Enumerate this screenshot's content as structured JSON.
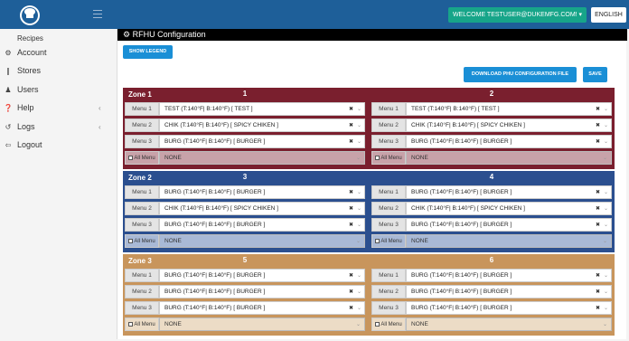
{
  "header": {
    "welcome": "WELCOME TESTUSER@DUKEMFG.COM! ▾",
    "language": "ENGLISH"
  },
  "sidebar": {
    "items": [
      {
        "label": "Recipes",
        "icon": "",
        "caret": ""
      },
      {
        "label": "Account",
        "icon": "⚙",
        "caret": ""
      },
      {
        "label": "Stores",
        "icon": "❙",
        "caret": ""
      },
      {
        "label": "Users",
        "icon": "♟",
        "caret": ""
      },
      {
        "label": "Help",
        "icon": "❓",
        "caret": "‹"
      },
      {
        "label": "Logs",
        "icon": "↺",
        "caret": "‹"
      },
      {
        "label": "Logout",
        "icon": "⇦",
        "caret": ""
      }
    ]
  },
  "page": {
    "title": "RFHU Configuration",
    "title_icon": "⚙",
    "show_legend": "SHOW LEGEND",
    "download": "DOWNLOAD PHU CONFIGURATION FILE",
    "save": "SAVE"
  },
  "zones": [
    {
      "name": "Zone 1",
      "color": "#7a1f2e",
      "tint": "#c8a2a9",
      "cols": [
        {
          "number": "1",
          "menus": [
            {
              "label": "Menu 1",
              "value": "TEST (T:140°F| B:140°F) [ TEST ]"
            },
            {
              "label": "Menu 2",
              "value": "CHIK (T:140°F| B:140°F) [ SPICY CHIKEN ]"
            },
            {
              "label": "Menu 3",
              "value": "BURG (T:140°F| B:140°F) [ BURGER ]"
            }
          ],
          "all_label": "All Menu",
          "all_value": "NONE"
        },
        {
          "number": "2",
          "menus": [
            {
              "label": "Menu 1",
              "value": "TEST (T:140°F| B:140°F) [ TEST ]"
            },
            {
              "label": "Menu 2",
              "value": "CHIK (T:140°F| B:140°F) [ SPICY CHIKEN ]"
            },
            {
              "label": "Menu 3",
              "value": "BURG (T:140°F| B:140°F) [ BURGER ]"
            }
          ],
          "all_label": "All Menu",
          "all_value": "NONE"
        }
      ]
    },
    {
      "name": "Zone 2",
      "color": "#2b4f8f",
      "tint": "#a9b9d6",
      "cols": [
        {
          "number": "3",
          "menus": [
            {
              "label": "Menu 1",
              "value": "BURG (T:140°F| B:140°F) [ BURGER ]"
            },
            {
              "label": "Menu 2",
              "value": "CHIK (T:140°F| B:140°F) [ SPICY CHIKEN ]"
            },
            {
              "label": "Menu 3",
              "value": "BURG (T:140°F| B:140°F) [ BURGER ]"
            }
          ],
          "all_label": "All Menu",
          "all_value": "NONE"
        },
        {
          "number": "4",
          "menus": [
            {
              "label": "Menu 1",
              "value": "BURG (T:140°F| B:140°F) [ BURGER ]"
            },
            {
              "label": "Menu 2",
              "value": "CHIK (T:140°F| B:140°F) [ SPICY CHIKEN ]"
            },
            {
              "label": "Menu 3",
              "value": "BURG (T:140°F| B:140°F) [ BURGER ]"
            }
          ],
          "all_label": "All Menu",
          "all_value": "NONE"
        }
      ]
    },
    {
      "name": "Zone 3",
      "color": "#c8955c",
      "tint": "#ecdcc6",
      "cols": [
        {
          "number": "5",
          "menus": [
            {
              "label": "Menu 1",
              "value": "BURG (T:140°F| B:140°F) [ BURGER ]"
            },
            {
              "label": "Menu 2",
              "value": "BURG (T:140°F| B:140°F) [ BURGER ]"
            },
            {
              "label": "Menu 3",
              "value": "BURG (T:140°F| B:140°F) [ BURGER ]"
            }
          ],
          "all_label": "All Menu",
          "all_value": "NONE"
        },
        {
          "number": "6",
          "menus": [
            {
              "label": "Menu 1",
              "value": "BURG (T:140°F| B:140°F) [ BURGER ]"
            },
            {
              "label": "Menu 2",
              "value": "BURG (T:140°F| B:140°F) [ BURGER ]"
            },
            {
              "label": "Menu 3",
              "value": "BURG (T:140°F| B:140°F) [ BURGER ]"
            }
          ],
          "all_label": "All Menu",
          "all_value": "NONE"
        }
      ]
    }
  ]
}
